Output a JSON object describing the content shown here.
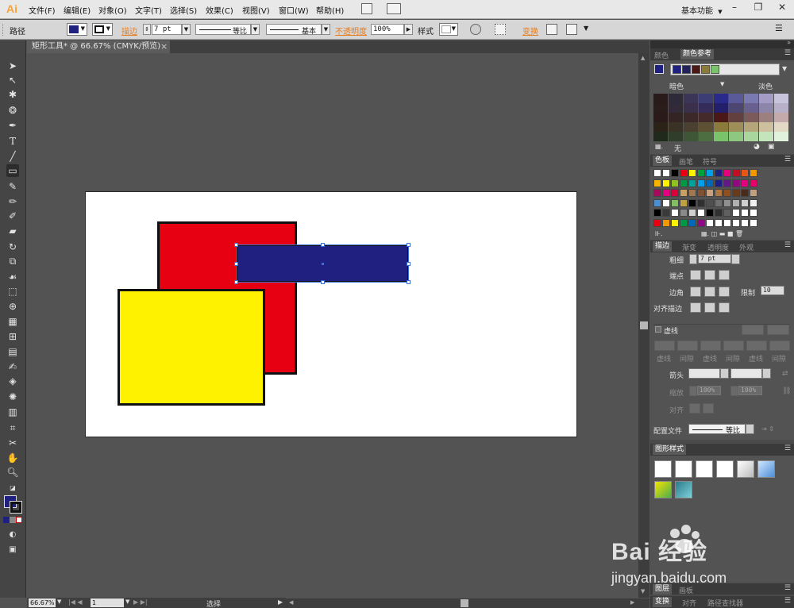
{
  "app": {
    "logo": "Ai"
  },
  "menu": {
    "items": [
      "文件(F)",
      "编辑(E)",
      "对象(O)",
      "文字(T)",
      "选择(S)",
      "效果(C)",
      "视图(V)",
      "窗口(W)",
      "帮助(H)"
    ],
    "workspace": "基本功能",
    "window_controls": [
      "–",
      "❐",
      "✕"
    ]
  },
  "control_bar": {
    "object_type": "路径",
    "fill_color": "#1f2080",
    "stroke_label": "描边",
    "stroke_weight": "7 pt",
    "stroke_profile": "等比",
    "brush": "基本",
    "opacity_label": "不透明度",
    "opacity": "100%",
    "style_label": "样式",
    "transform_label": "变换"
  },
  "document": {
    "tab_title": "矩形工具* @ 66.67% (CMYK/预览)",
    "close": "×"
  },
  "canvas": {
    "shapes": [
      {
        "name": "red-rectangle",
        "color": "#e60012"
      },
      {
        "name": "yellow-rectangle",
        "color": "#fff200"
      },
      {
        "name": "blue-rectangle",
        "color": "#1f2080",
        "selected": true
      }
    ]
  },
  "status_bar": {
    "zoom": "66.67%",
    "page": "1",
    "tool": "选择"
  },
  "panels": {
    "color": {
      "tabs": [
        "颜色",
        "颜色参考"
      ],
      "left_label": "暗色",
      "right_label": "淡色",
      "none_label": "无",
      "harmony": [
        "#1f2080",
        "#22225a",
        "#4b1818",
        "#8a7a3c",
        "#7ac36a"
      ],
      "grid": [
        [
          "#2a1b1b",
          "#2e2a3a",
          "#3b3558",
          "#3d3d75",
          "#2a2a8a",
          "#5a5a9a",
          "#7a7ab0",
          "#a49cc4",
          "#c8c4dc"
        ],
        [
          "#2b1c1c",
          "#332a38",
          "#3a304c",
          "#352c5a",
          "#231f6a",
          "#4d4670",
          "#6a6090",
          "#8e86a8",
          "#b8b0c8"
        ],
        [
          "#2b1a1a",
          "#342424",
          "#3c2828",
          "#442a2a",
          "#4b1818",
          "#634040",
          "#7a5a5a",
          "#9c8080",
          "#c4aaaa"
        ],
        [
          "#2b2218",
          "#3a3224",
          "#4a4030",
          "#5e5034",
          "#8a7a3c",
          "#9e8e5a",
          "#b4a67a",
          "#ccc09e",
          "#e2dac4"
        ],
        [
          "#1f2a1c",
          "#2e3e2a",
          "#3e5636",
          "#4c6e40",
          "#7ac36a",
          "#8ec880",
          "#a8d69c",
          "#c4e4bc",
          "#e0f2dc"
        ]
      ]
    },
    "swatches": {
      "tabs": [
        "色板",
        "画笔",
        "符号"
      ],
      "rows": [
        [
          "#ffffff",
          "#ffffff",
          "#000000",
          "#e60012",
          "#fff200",
          "#00a040",
          "#00a0e9",
          "#1f2080",
          "#e4007f",
          "#c30d23",
          "#e95513",
          "#f39800"
        ],
        [
          "#f8b500",
          "#fff100",
          "#8fc31f",
          "#009944",
          "#00a29a",
          "#00a0e9",
          "#0068b7",
          "#1d2088",
          "#601986",
          "#920783",
          "#e4007f",
          "#e5006a"
        ],
        [
          "#a40b5d",
          "#e4007f",
          "#d7003a",
          "#c8a063",
          "#a07850",
          "#805030",
          "#c8a080",
          "#b07840",
          "#905020",
          "#6a3a1a",
          "#4a2a1a",
          "#c0a080"
        ],
        [
          "#4a90d0",
          "#ffffff",
          "#80c060",
          "#c0a040",
          "#000000",
          "#303030",
          "#505050",
          "#707070",
          "#909090",
          "#b0b0b0",
          "#d0d0d0",
          "#f0f0f0"
        ],
        [
          "#000000",
          "#3a3a3a",
          "#ffffff",
          "#8a8a8a",
          "#d0d0d0",
          "#ffffff",
          "#000000",
          "#303030",
          "#606060",
          "#ffffff",
          "#ffffff",
          "#ffffff"
        ],
        [
          "#e60012",
          "#f39800",
          "#fff100",
          "#009944",
          "#0068b7",
          "#920783",
          "#ffffff",
          "#ffffff",
          "#ffffff",
          "#ffffff",
          "#ffffff",
          "#ffffff"
        ]
      ]
    },
    "stroke": {
      "tabs": [
        "描边",
        "渐变",
        "透明度",
        "外观"
      ],
      "weight_label": "粗细",
      "weight": "7 pt",
      "cap_label": "端点",
      "corner_label": "边角",
      "limit_label": "限制",
      "limit": "10",
      "align_label": "对齐描边",
      "dashed_label": "虚线",
      "dash_labels": [
        "虚线",
        "间隙",
        "虚线",
        "间隙",
        "虚线",
        "间隙"
      ],
      "arrow_label": "箭头",
      "scale_label": "缩放",
      "scale_values": [
        "100%",
        "100%"
      ],
      "align2_label": "对齐",
      "profile_label": "配置文件",
      "profile": "等比"
    },
    "graphic_styles": {
      "tab": "图形样式"
    },
    "bottom_tabs_1": [
      "图层",
      "画板"
    ],
    "bottom_tabs_2": [
      "变换",
      "对齐",
      "路径查找器"
    ]
  },
  "watermark": {
    "brand": "Bai 经验",
    "url": "jingyan.baidu.com"
  }
}
